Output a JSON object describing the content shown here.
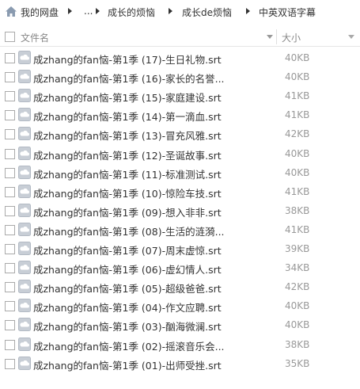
{
  "breadcrumb": {
    "items": [
      "我的网盘",
      "...",
      "成长的烦恼",
      "成长de烦恼",
      "中英双语字幕"
    ]
  },
  "header": {
    "name_label": "文件名",
    "size_label": "大小"
  },
  "files": [
    {
      "name": "成zhang的fan恼-第1季 (17)-生日礼物.srt",
      "size": "40KB"
    },
    {
      "name": "成zhang的fan恼-第1季 (16)-家长的名誉...",
      "size": "40KB"
    },
    {
      "name": "成zhang的fan恼-第1季 (15)-家庭建设.srt",
      "size": "41KB"
    },
    {
      "name": "成zhang的fan恼-第1季 (14)-第一滴血.srt",
      "size": "41KB"
    },
    {
      "name": "成zhang的fan恼-第1季 (13)-冒充风雅.srt",
      "size": "42KB"
    },
    {
      "name": "成zhang的fan恼-第1季 (12)-圣诞故事.srt",
      "size": "40KB"
    },
    {
      "name": "成zhang的fan恼-第1季 (11)-标准测试.srt",
      "size": "40KB"
    },
    {
      "name": "成zhang的fan恼-第1季 (10)-惊险车技.srt",
      "size": "41KB"
    },
    {
      "name": "成zhang的fan恼-第1季 (09)-想入非非.srt",
      "size": "38KB"
    },
    {
      "name": "成zhang的fan恼-第1季 (08)-生活的涟漪...",
      "size": "41KB"
    },
    {
      "name": "成zhang的fan恼-第1季 (07)-周末虚惊.srt",
      "size": "39KB"
    },
    {
      "name": "成zhang的fan恼-第1季 (06)-虚幻情人.srt",
      "size": "34KB"
    },
    {
      "name": "成zhang的fan恼-第1季 (05)-超级爸爸.srt",
      "size": "42KB"
    },
    {
      "name": "成zhang的fan恼-第1季 (04)-作文应聘.srt",
      "size": "40KB"
    },
    {
      "name": "成zhang的fan恼-第1季 (03)-酗海微澜.srt",
      "size": "40KB"
    },
    {
      "name": "成zhang的fan恼-第1季 (02)-摇滚音乐会...",
      "size": "38KB"
    },
    {
      "name": "成zhang的fan恼-第1季 (01)-出师受挫.srt",
      "size": "35KB"
    }
  ],
  "icons": {
    "home": "home-icon",
    "file": "cloud-file-icon"
  }
}
